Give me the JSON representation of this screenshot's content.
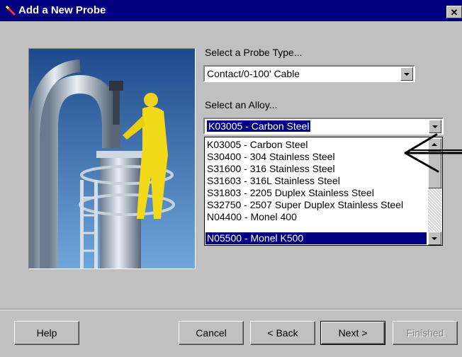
{
  "window": {
    "title": "Add a New Probe",
    "close_label": "✕"
  },
  "probe_type": {
    "label": "Select a Probe Type...",
    "value": "Contact/0-100' Cable"
  },
  "alloy": {
    "label": "Select an Alloy...",
    "value": "K03005 - Carbon Steel",
    "options": [
      "K03005 - Carbon Steel",
      "S30400 - 304 Stainless Steel",
      "S31600 - 316 Stainless Steel",
      "S31603 - 316L Stainless Steel",
      "S31803 - 2205 Duplex Stainless Steel",
      "S32750 - 2507 Super Duplex Stainless Steel",
      "N04400 - Monel 400",
      "N05500 - Monel K500"
    ],
    "highlighted_index": 7
  },
  "buttons": {
    "help": "Help",
    "cancel": "Cancel",
    "back": "< Back",
    "next": "Next >",
    "finished": "Finished"
  },
  "colors": {
    "title_bar": "#000080",
    "dialog_bg": "#c0c0c0",
    "selection": "#000080"
  },
  "icons": {
    "title": "probe-wand-icon",
    "annotation": "hand-drawn-arrow-icon"
  }
}
